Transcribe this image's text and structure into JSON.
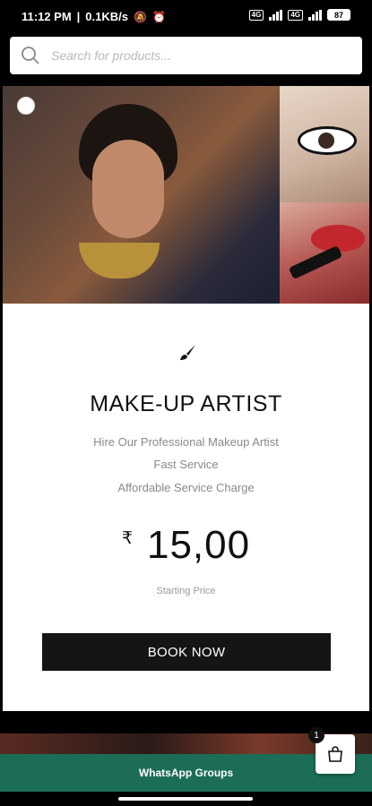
{
  "status_bar": {
    "time": "11:12 PM",
    "speed": "0.1KB/s",
    "battery": "87",
    "sim1": "4G",
    "sim2": "4G"
  },
  "search": {
    "placeholder": "Search for products..."
  },
  "service": {
    "title": "MAKE-UP ARTIST",
    "features": [
      "Hire Our Professional Makeup Artist",
      "Fast Service",
      "Affordable Service Charge"
    ],
    "currency": "₹",
    "price": "15,00",
    "price_note": "Starting Price",
    "book_label": "BOOK NOW"
  },
  "footer": {
    "whatsapp_label": "WhatsApp Groups",
    "cart_count": "1"
  },
  "colors": {
    "whatsapp_bar": "#1b6d55",
    "button": "#151515"
  }
}
